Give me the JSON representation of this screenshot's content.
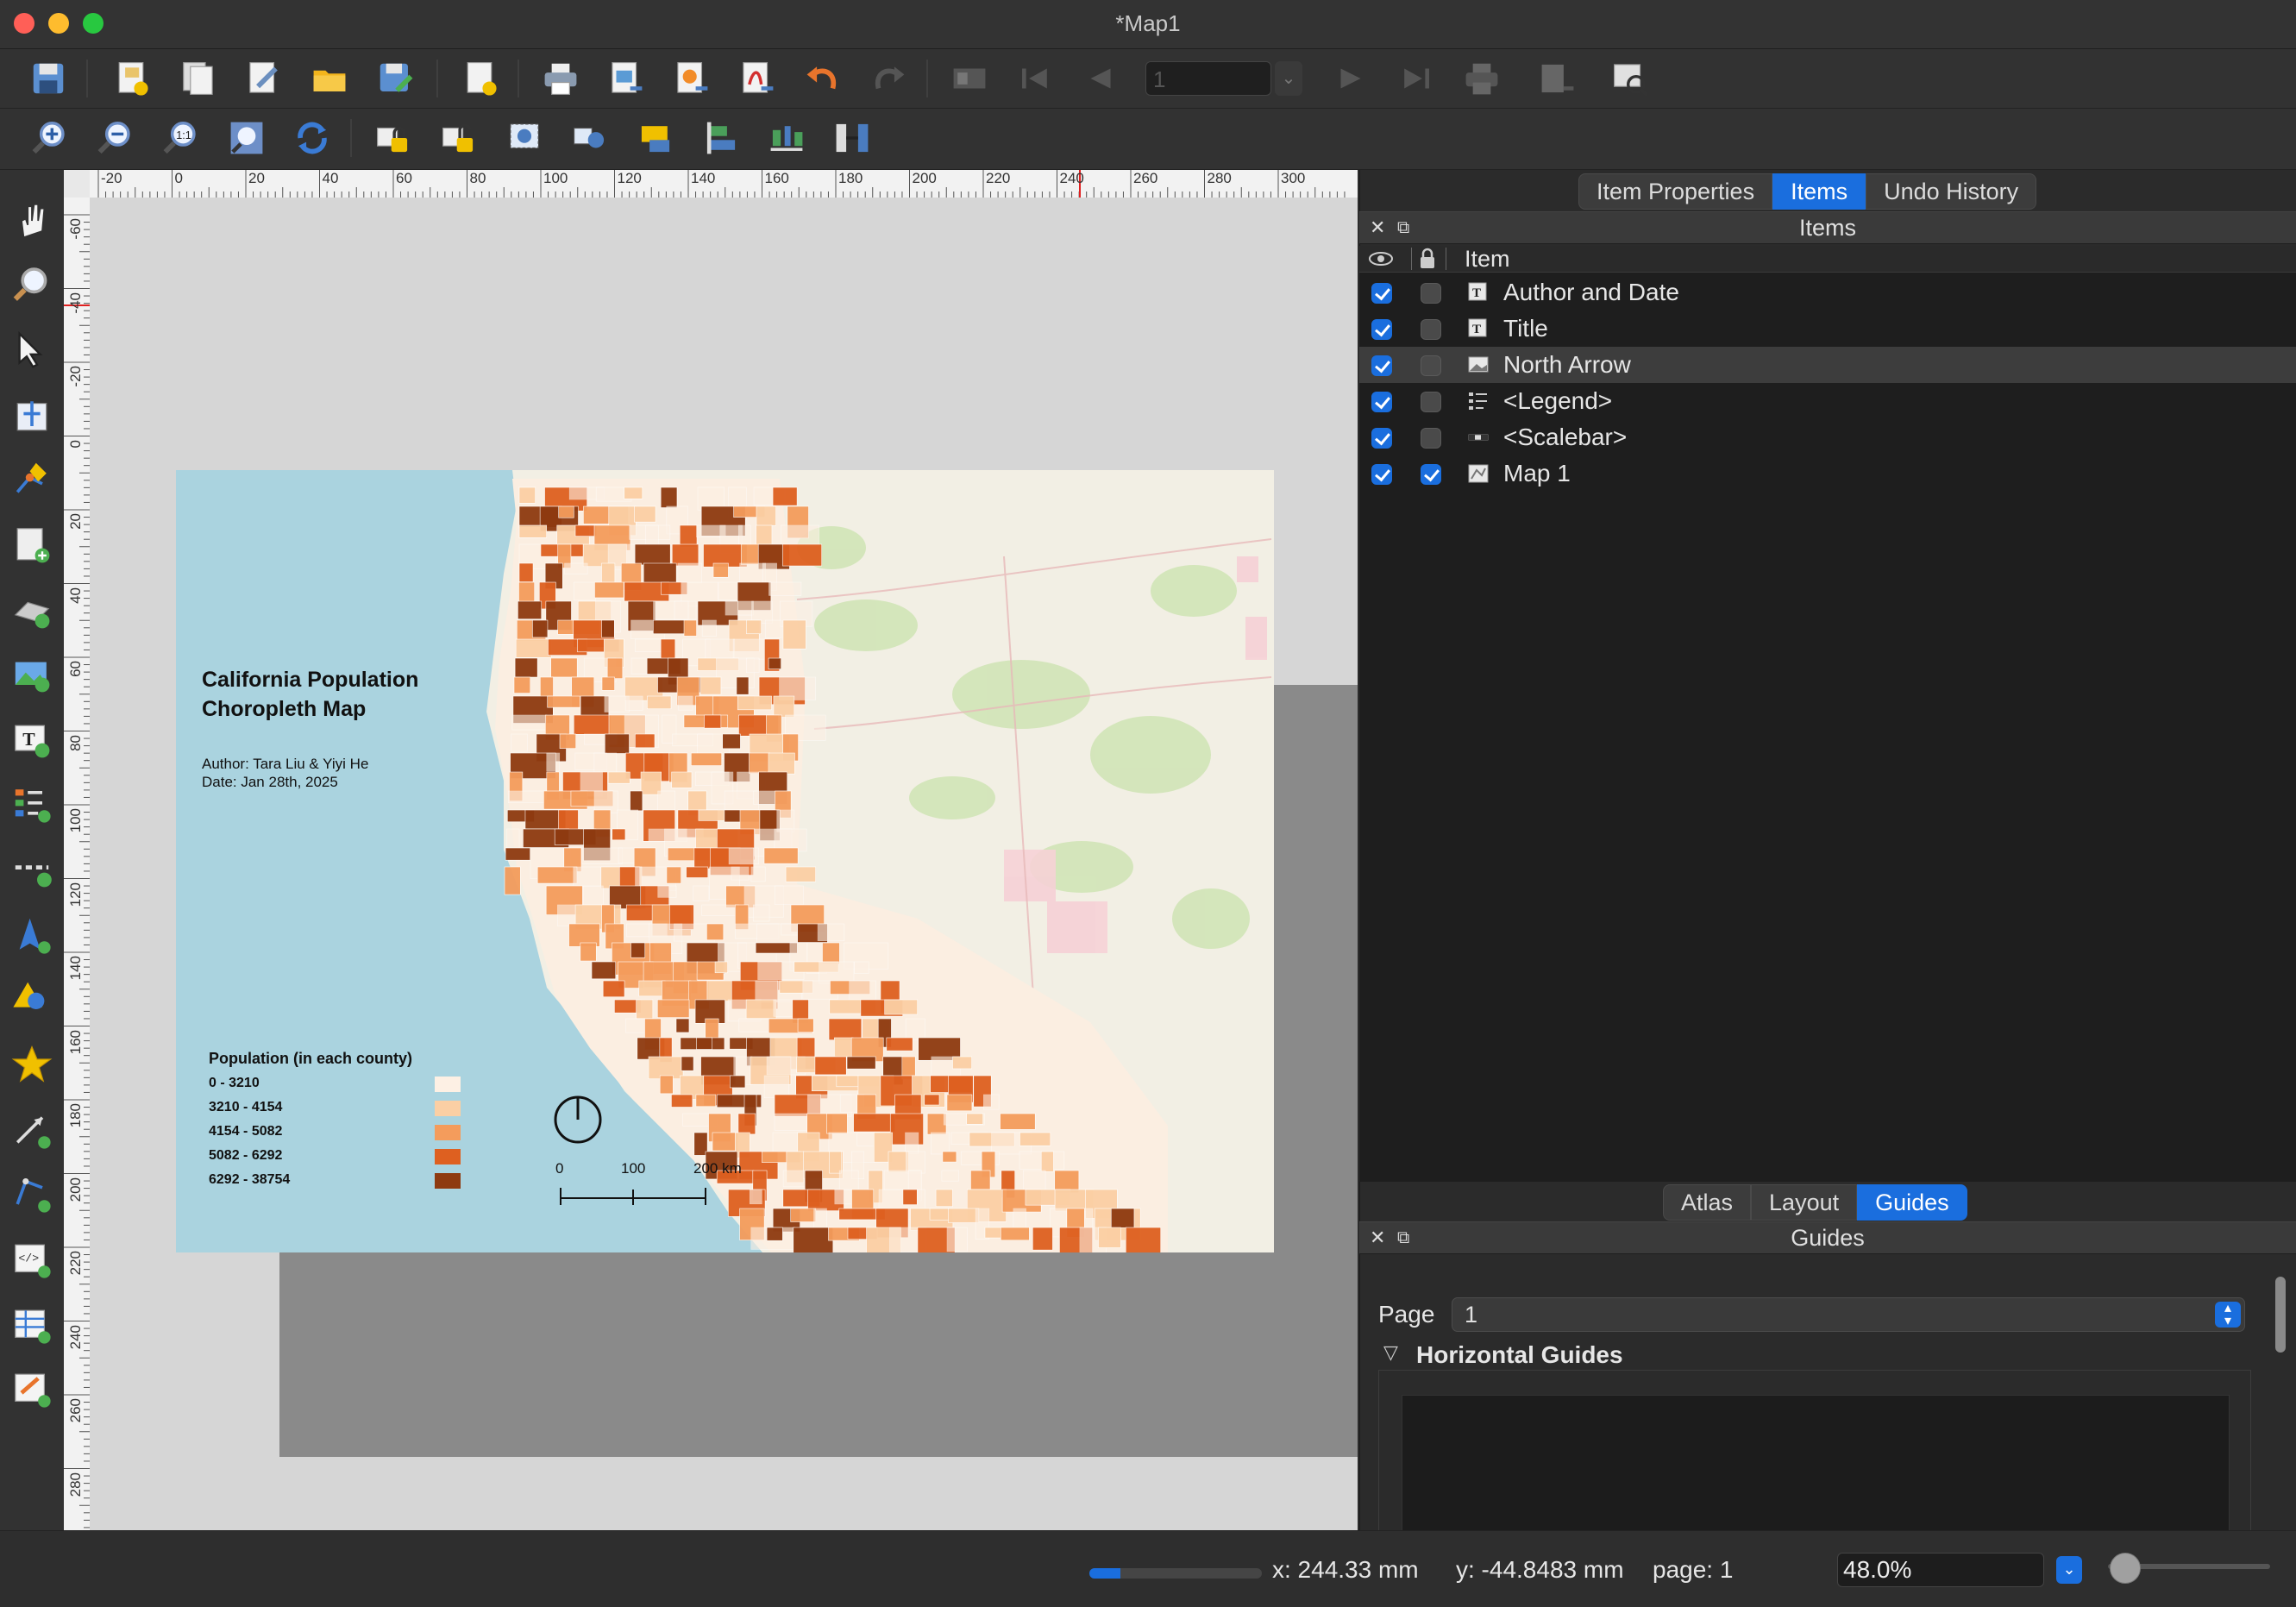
{
  "window": {
    "title": "*Map1"
  },
  "toolbar": {
    "page_number": "1"
  },
  "rulers": {
    "horizontal": [
      "-20",
      "0",
      "20",
      "40",
      "60",
      "80",
      "100",
      "120",
      "140",
      "160",
      "180",
      "200",
      "220",
      "240",
      "260",
      "280",
      "300"
    ],
    "vertical": [
      "-60",
      "-40",
      "-20",
      "0",
      "20",
      "40",
      "60",
      "80",
      "100",
      "120",
      "140",
      "160",
      "180",
      "200",
      "220",
      "240",
      "260",
      "280"
    ]
  },
  "layout": {
    "map_title": "California Population\nChoropleth Map",
    "author_date": "Author: Tara Liu & Yiyi He\nDate: Jan 28th,  2025",
    "legend": {
      "title": "Population (in each county)",
      "items": [
        {
          "label": "0 - 3210",
          "color": "#fdf0e4"
        },
        {
          "label": "3210 - 4154",
          "color": "#fbcfa4"
        },
        {
          "label": "4154 - 5082",
          "color": "#f49c5c"
        },
        {
          "label": "5082 - 6292",
          "color": "#de6020"
        },
        {
          "label": "6292 - 38754",
          "color": "#8e3a10"
        }
      ]
    },
    "scalebar": {
      "labels": [
        "0",
        "100",
        "200 km"
      ]
    }
  },
  "items_panel": {
    "tabs": [
      "Item Properties",
      "Items",
      "Undo History"
    ],
    "active_tab": "Items",
    "header": "Items",
    "column_item": "Item",
    "rows": [
      {
        "label": "Author and Date",
        "type_icon": "text-icon",
        "visible": true,
        "locked": false
      },
      {
        "label": "Title",
        "type_icon": "text-icon",
        "visible": true,
        "locked": false
      },
      {
        "label": "North Arrow",
        "type_icon": "picture-icon",
        "visible": true,
        "locked": false,
        "selected": true
      },
      {
        "label": "<Legend>",
        "type_icon": "legend-icon",
        "visible": true,
        "locked": false
      },
      {
        "label": "<Scalebar>",
        "type_icon": "scalebar-icon",
        "visible": true,
        "locked": false
      },
      {
        "label": "Map 1",
        "type_icon": "map-icon",
        "visible": true,
        "locked": true
      }
    ]
  },
  "guides_panel": {
    "tabs": [
      "Atlas",
      "Layout",
      "Guides"
    ],
    "active_tab": "Guides",
    "header": "Guides",
    "page_label": "Page",
    "page_value": "1",
    "horizontal_guides": "Horizontal Guides"
  },
  "status": {
    "x": "x: 244.33 mm",
    "y": "y: -44.8483 mm",
    "page": "page: 1",
    "zoom": "48.0%",
    "progress": 0.18
  },
  "colors": {
    "accent": "#1a6ede",
    "sea": "#aad3df"
  }
}
